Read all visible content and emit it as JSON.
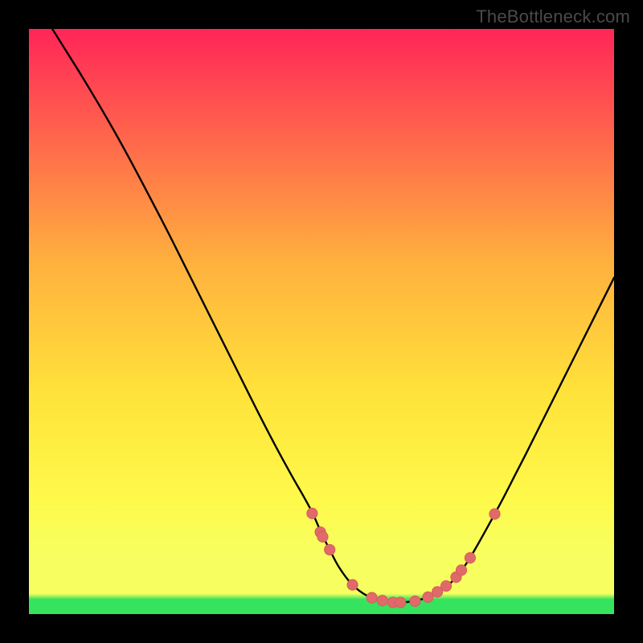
{
  "attribution": "TheBottleneck.com",
  "colors": {
    "frame": "#000000",
    "text": "#4a4a4a",
    "curve_stroke": "#000000",
    "marker_fill": "#e06a6a",
    "marker_stroke": "#d55d5d",
    "grad_top": "#ff2558",
    "grad_mid_high": "#ffb13e",
    "grad_mid": "#ffe23a",
    "grad_low": "#fff94a",
    "grad_band": "#f7ff60",
    "grad_bottom": "#36e35e"
  },
  "chart_data": {
    "type": "line",
    "title": "",
    "xlabel": "",
    "ylabel": "",
    "xlim": [
      0,
      100
    ],
    "ylim": [
      0,
      100
    ],
    "curve": [
      {
        "x": 4.0,
        "y": 100.0
      },
      {
        "x": 6.0,
        "y": 96.8
      },
      {
        "x": 9.0,
        "y": 92.0
      },
      {
        "x": 12.0,
        "y": 87.0
      },
      {
        "x": 15.0,
        "y": 81.8
      },
      {
        "x": 18.0,
        "y": 76.3
      },
      {
        "x": 21.0,
        "y": 70.6
      },
      {
        "x": 24.0,
        "y": 64.8
      },
      {
        "x": 27.0,
        "y": 58.8
      },
      {
        "x": 30.0,
        "y": 52.8
      },
      {
        "x": 33.0,
        "y": 46.8
      },
      {
        "x": 36.0,
        "y": 40.8
      },
      {
        "x": 39.0,
        "y": 34.8
      },
      {
        "x": 42.0,
        "y": 29.0
      },
      {
        "x": 45.0,
        "y": 23.5
      },
      {
        "x": 47.0,
        "y": 20.0
      },
      {
        "x": 48.5,
        "y": 17.2
      },
      {
        "x": 50.0,
        "y": 13.8
      },
      {
        "x": 51.5,
        "y": 10.8
      },
      {
        "x": 53.0,
        "y": 8.0
      },
      {
        "x": 55.0,
        "y": 5.3
      },
      {
        "x": 57.0,
        "y": 3.6
      },
      {
        "x": 59.0,
        "y": 2.6
      },
      {
        "x": 61.0,
        "y": 2.1
      },
      {
        "x": 63.0,
        "y": 2.0
      },
      {
        "x": 65.0,
        "y": 2.1
      },
      {
        "x": 67.0,
        "y": 2.5
      },
      {
        "x": 69.0,
        "y": 3.2
      },
      {
        "x": 71.0,
        "y": 4.4
      },
      {
        "x": 73.0,
        "y": 6.3
      },
      {
        "x": 75.0,
        "y": 9.0
      },
      {
        "x": 77.0,
        "y": 12.4
      },
      {
        "x": 79.0,
        "y": 16.0
      },
      {
        "x": 81.0,
        "y": 19.7
      },
      {
        "x": 83.0,
        "y": 23.6
      },
      {
        "x": 85.0,
        "y": 27.5
      },
      {
        "x": 88.0,
        "y": 33.5
      },
      {
        "x": 91.0,
        "y": 39.5
      },
      {
        "x": 94.0,
        "y": 45.5
      },
      {
        "x": 97.0,
        "y": 51.5
      },
      {
        "x": 100.0,
        "y": 57.5
      }
    ],
    "markers": [
      {
        "x": 48.4,
        "y": 17.2
      },
      {
        "x": 49.8,
        "y": 14.0
      },
      {
        "x": 50.2,
        "y": 13.2
      },
      {
        "x": 51.4,
        "y": 11.0
      },
      {
        "x": 55.3,
        "y": 5.0
      },
      {
        "x": 58.6,
        "y": 2.8
      },
      {
        "x": 60.4,
        "y": 2.3
      },
      {
        "x": 62.2,
        "y": 2.0
      },
      {
        "x": 63.5,
        "y": 2.0
      },
      {
        "x": 66.0,
        "y": 2.2
      },
      {
        "x": 68.2,
        "y": 2.9
      },
      {
        "x": 69.8,
        "y": 3.8
      },
      {
        "x": 71.3,
        "y": 4.8
      },
      {
        "x": 73.0,
        "y": 6.3
      },
      {
        "x": 73.9,
        "y": 7.5
      },
      {
        "x": 75.4,
        "y": 9.6
      },
      {
        "x": 79.6,
        "y": 17.1
      }
    ]
  }
}
